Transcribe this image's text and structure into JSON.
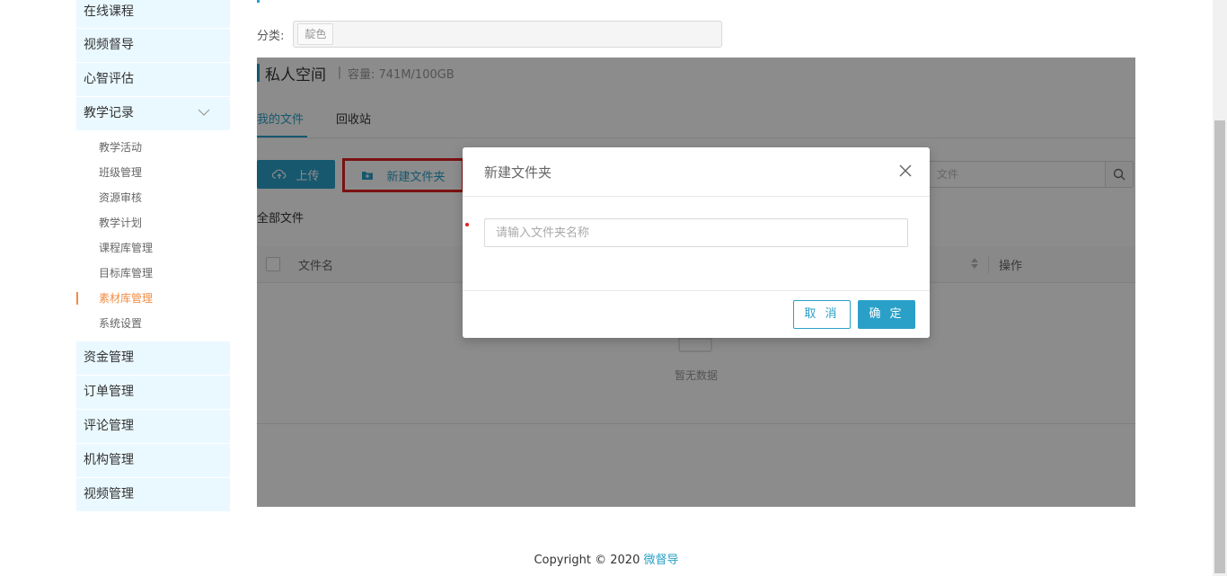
{
  "sidebar": {
    "items_top": [
      {
        "label": "在线课程"
      },
      {
        "label": "视频督导"
      },
      {
        "label": "心智评估"
      },
      {
        "label": "教学记录"
      }
    ],
    "sub_items": [
      {
        "label": "教学活动"
      },
      {
        "label": "班级管理"
      },
      {
        "label": "资源审核"
      },
      {
        "label": "教学计划"
      },
      {
        "label": "课程库管理"
      },
      {
        "label": "目标库管理"
      },
      {
        "label": "素材库管理",
        "active": true
      },
      {
        "label": "系统设置"
      }
    ],
    "items_bottom": [
      {
        "label": "资金管理"
      },
      {
        "label": "订单管理"
      },
      {
        "label": "评论管理"
      },
      {
        "label": "机构管理"
      },
      {
        "label": "视频管理"
      }
    ]
  },
  "category": {
    "label": "分类:",
    "tag": "靛色"
  },
  "panel": {
    "title": "私人空间",
    "capacity": "容量: 741M/100GB",
    "tabs": [
      {
        "label": "我的文件",
        "active": true
      },
      {
        "label": "回收站"
      }
    ],
    "upload_label": "上传",
    "new_folder_label": "新建文件夹",
    "search_placeholder": "文件",
    "all_files_label": "全部文件",
    "columns": {
      "name": "文件名",
      "action": "操作"
    },
    "empty_text": "暂无数据"
  },
  "modal": {
    "title": "新建文件夹",
    "input_placeholder": "请输入文件夹名称",
    "cancel_label": "取 消",
    "ok_label": "确 定"
  },
  "footer": {
    "copyright": "Copyright © 2020",
    "brand": "微督导"
  },
  "colors": {
    "accent": "#2aa0c8",
    "active_menu": "#f08c44",
    "highlight_border": "#e02020"
  }
}
